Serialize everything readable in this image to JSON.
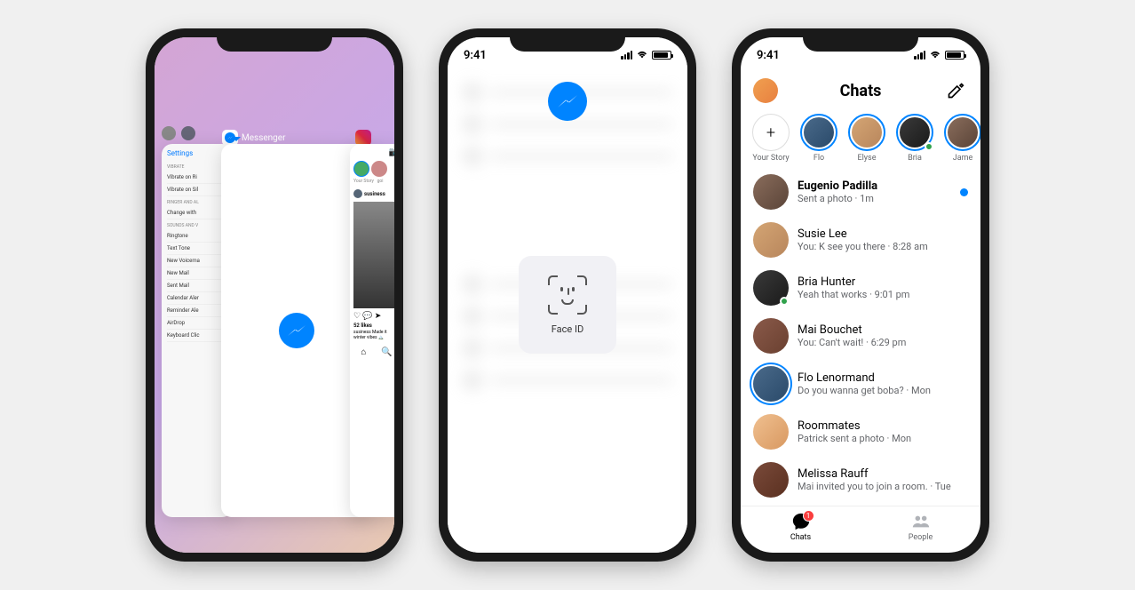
{
  "status": {
    "time": "9:41"
  },
  "phone1": {
    "apps": {
      "messenger": "Messenger",
      "instagram": "Instagram"
    },
    "settings": {
      "back": "Settings",
      "headers": {
        "vibrate": "VIBRATE",
        "ringer": "RINGER AND AL",
        "sounds": "SOUNDS AND V"
      },
      "rows": [
        "Vibrate on Ri",
        "Vibrate on Sil",
        "Change with",
        "Ringtone",
        "Text Tone",
        "New Voicema",
        "New Mail",
        "Sent Mail",
        "Calendar Aler",
        "Reminder Ale",
        "AirDrop",
        "Keyboard Clic"
      ]
    },
    "insta": {
      "user": "susiness",
      "likes": "52 likes",
      "caption": "susiness Made it winter vibes 🏔️"
    }
  },
  "phone2": {
    "faceid_label": "Face ID"
  },
  "phone3": {
    "title": "Chats",
    "stories": [
      {
        "label": "Your Story",
        "add": true
      },
      {
        "label": "Flo",
        "online": false
      },
      {
        "label": "Elyse",
        "online": false
      },
      {
        "label": "Bria",
        "online": true
      },
      {
        "label": "Jame",
        "online": false
      }
    ],
    "chats": [
      {
        "name": "Eugenio Padilla",
        "preview": "Sent a photo · 1m",
        "bold": true,
        "unread": true,
        "av": "av1"
      },
      {
        "name": "Susie Lee",
        "preview": "You: K see you there · 8:28 am",
        "av": "av2"
      },
      {
        "name": "Bria Hunter",
        "preview": "Yeah that works · 9:01 pm",
        "online": true,
        "av": "av3"
      },
      {
        "name": "Mai Bouchet",
        "preview": "You: Can't wait! · 6:29 pm",
        "av": "av4"
      },
      {
        "name": "Flo Lenormand",
        "preview": "Do you wanna get boba? · Mon",
        "ring": true,
        "av": "av5"
      },
      {
        "name": "Roommates",
        "preview": "Patrick sent a photo · Mon",
        "av": "av6"
      },
      {
        "name": "Melissa Rauff",
        "preview": "Mai invited you to join a room. · Tue",
        "av": "av7"
      }
    ],
    "tabs": {
      "chats": "Chats",
      "people": "People",
      "badge": "1"
    }
  }
}
